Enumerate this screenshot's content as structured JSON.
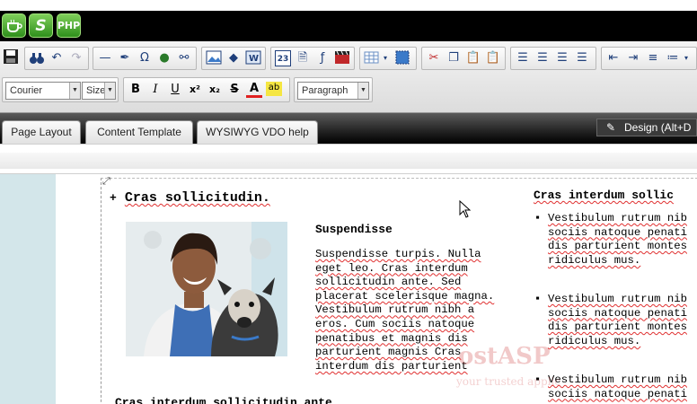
{
  "app_icons": [
    {
      "icon": "cup-icon",
      "label": ""
    },
    {
      "icon": "s-logo-icon",
      "label": "S"
    },
    {
      "icon": "php-icon",
      "label": "PHP"
    }
  ],
  "toolbar": {
    "font_select": "Courier",
    "size_select": "Size",
    "format_select": "Paragraph",
    "bold": "B",
    "italic": "I",
    "underline": "U",
    "superscript": "x²",
    "subscript": "x₂",
    "strike": "S",
    "font_color": "A",
    "highlight": "ab",
    "omega": "Ω",
    "date_number": "23"
  },
  "tabs": [
    {
      "label": "Page Layout"
    },
    {
      "label": "Content Template"
    },
    {
      "label": "WYSIWYG VDO help"
    }
  ],
  "design_tab": "Design (Alt+D",
  "content": {
    "heading1": "Cras sollicitudin.",
    "bullet_plus": "+",
    "subheading": "Suspendisse",
    "paragraph_lines": [
      "Suspendisse turpis. Nulla",
      "eget leo. Cras interdum",
      "sollicitudin ante. Sed",
      "placerat scelerisque magna.",
      "Vestibulum rutrum nibh a",
      "eros. Cum sociis natoque",
      "penatibus et magnis dis",
      "parturient magnis Cras",
      "interdum dis parturient"
    ],
    "right_heading": "Cras interdum sollic",
    "right_bullets": [
      [
        "Vestibulum rutrum nib",
        "sociis natoque penati",
        "dis parturient montes",
        "ridiculus mus."
      ],
      [
        "Vestibulum rutrum nib",
        "sociis natoque penati",
        "dis parturient montes",
        "ridiculus mus."
      ],
      [
        "Vestibulum rutrum nib",
        "sociis natoque penati"
      ]
    ],
    "bottom_line": "Cras interdum sollicitudin ante."
  },
  "watermark": {
    "line1": "ostASP",
    "line2": "your trusted applic"
  },
  "colors": {
    "accent_green": "#3a9a22",
    "sidepanel": "#d3e6ea",
    "squiggle": "#e03030"
  }
}
